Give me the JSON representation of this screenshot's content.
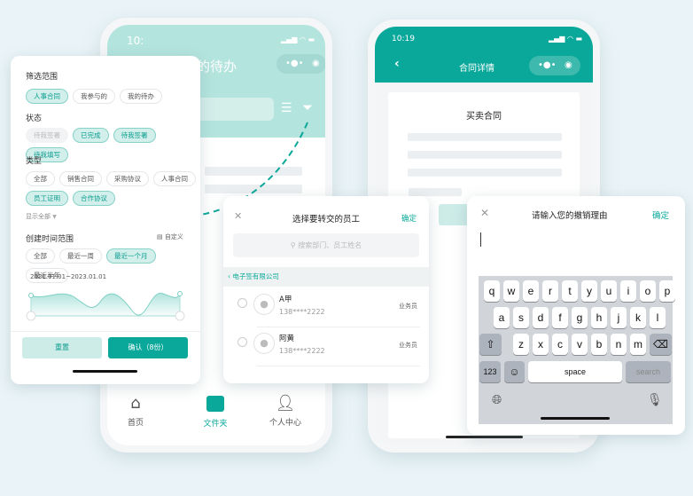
{
  "colors": {
    "accent": "#0aa89a",
    "accent_light": "#d3efeb",
    "background": "#eaf4f8"
  },
  "phone_todo": {
    "time": "10:",
    "title": "我的待办",
    "tabbar": [
      {
        "label": "首页",
        "icon": "home-icon"
      },
      {
        "label": "文件夹",
        "icon": "folder-icon",
        "active": true
      },
      {
        "label": "个人中心",
        "icon": "user-icon"
      }
    ]
  },
  "phone_detail": {
    "time": "10:19",
    "title": "合同详情",
    "doc_title": "买卖合同"
  },
  "filter": {
    "scope_label": "筛选范围",
    "scope": [
      {
        "label": "人事合同",
        "state": "sel"
      },
      {
        "label": "我参与的"
      },
      {
        "label": "我的待办"
      }
    ],
    "status_label": "状态",
    "status": [
      {
        "label": "待我签署",
        "state": "dis"
      },
      {
        "label": "已完成",
        "state": "sel"
      },
      {
        "label": "待我签署",
        "state": "sel"
      },
      {
        "label": "待我填写",
        "state": "sel"
      }
    ],
    "type_label": "类型",
    "types": [
      {
        "label": "全部"
      },
      {
        "label": "销售合同"
      },
      {
        "label": "采购协议"
      },
      {
        "label": "人事合同"
      },
      {
        "label": "员工证明",
        "state": "sel"
      },
      {
        "label": "合作协议",
        "state": "sel"
      }
    ],
    "show_all": "显示全部",
    "time_label": "创建时间范围",
    "custom": "自定义",
    "time_ranges": [
      {
        "label": "全部"
      },
      {
        "label": "最近一周"
      },
      {
        "label": "最近一个月",
        "state": "sel"
      },
      {
        "label": "最近半年"
      }
    ],
    "date_range": "2021.01.01~2023.01.01",
    "reset": "重置",
    "confirm": "确认（8份）"
  },
  "employee": {
    "title": "选择要转交的员工",
    "confirm": "确定",
    "search_placeholder": "搜索部门、员工姓名",
    "company": "电子签有限公司",
    "list": [
      {
        "name": "A甲",
        "phone": "138****2222",
        "role": "业务员"
      },
      {
        "name": "阿黄",
        "phone": "138****2222",
        "role": "业务员"
      }
    ]
  },
  "revoke": {
    "title": "请输入您的撤销理由",
    "confirm": "确定",
    "keyboard": {
      "row1": [
        "q",
        "w",
        "e",
        "r",
        "t",
        "y",
        "u",
        "i",
        "o",
        "p"
      ],
      "row2": [
        "a",
        "s",
        "d",
        "f",
        "g",
        "h",
        "j",
        "k",
        "l"
      ],
      "row3": [
        "z",
        "x",
        "c",
        "v",
        "b",
        "n",
        "m"
      ],
      "numbers": "123",
      "space": "space",
      "search": "search"
    }
  }
}
